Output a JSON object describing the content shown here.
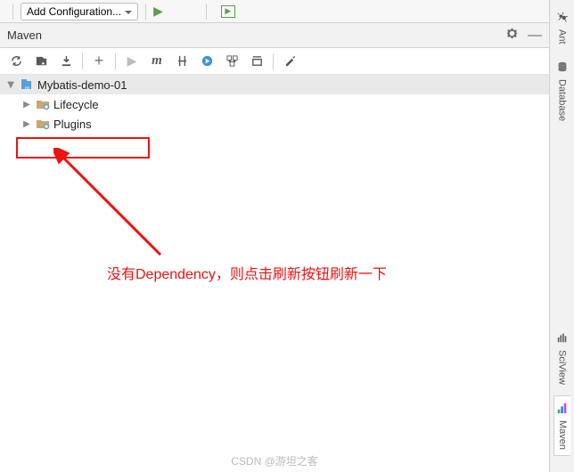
{
  "topbar": {
    "config_label": "Add Configuration..."
  },
  "panel": {
    "title": "Maven"
  },
  "tree": {
    "root": "Mybatis-demo-01",
    "children": [
      {
        "label": "Lifecycle"
      },
      {
        "label": "Plugins"
      }
    ]
  },
  "side_tabs": {
    "ant": "Ant",
    "database": "Database",
    "sciview": "SciView",
    "maven": "Maven"
  },
  "annotation": {
    "note": "没有Dependency，则点击刷新按钮刷新一下"
  },
  "watermark": "CSDN @游坦之客"
}
